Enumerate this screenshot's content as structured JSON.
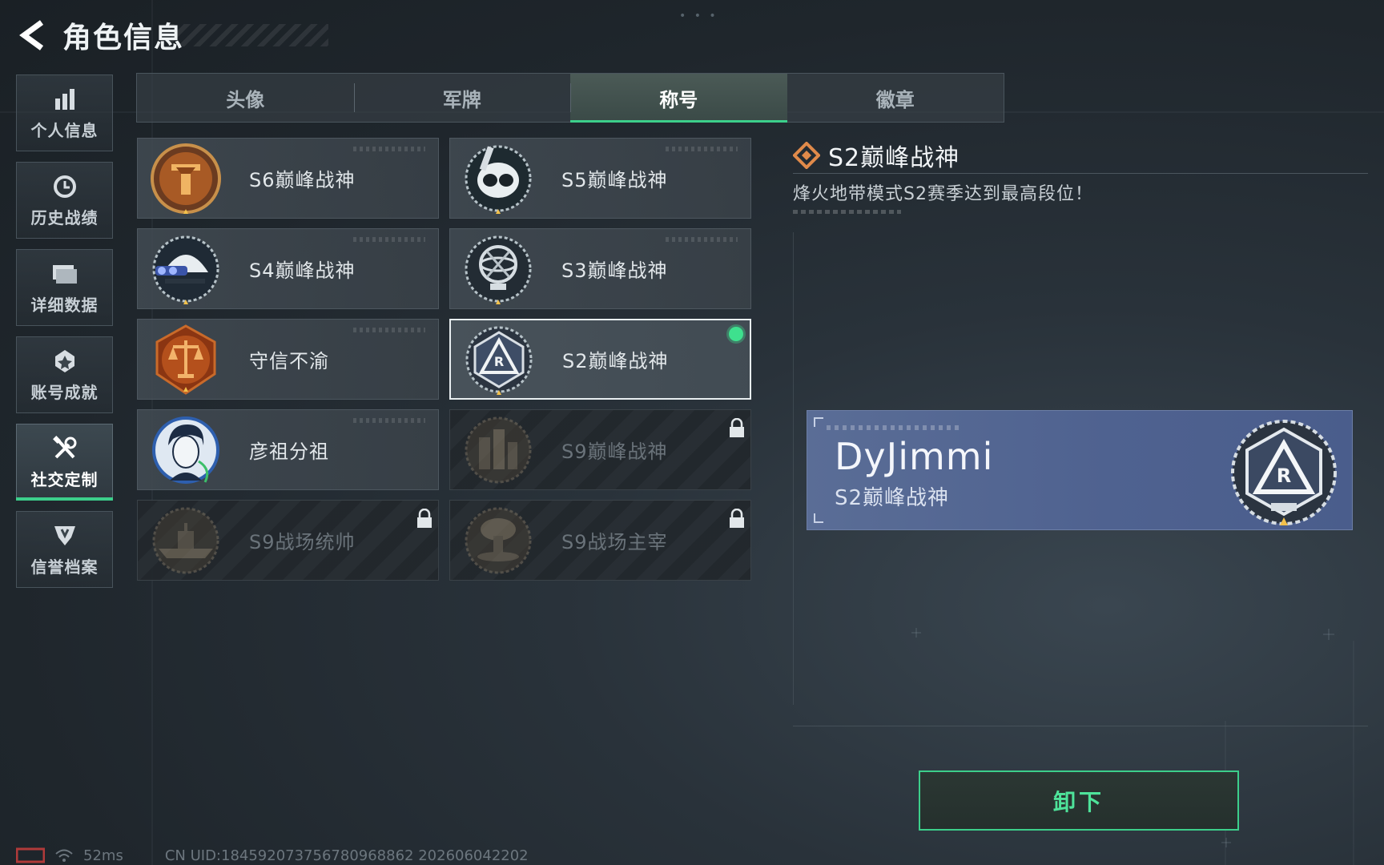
{
  "header": {
    "title": "角色信息"
  },
  "sidebar": {
    "items": [
      {
        "label": "个人信息",
        "icon": "bar-chart-icon"
      },
      {
        "label": "历史战绩",
        "icon": "history-clock-icon"
      },
      {
        "label": "详细数据",
        "icon": "folder-icon"
      },
      {
        "label": "账号成就",
        "icon": "achievement-icon"
      },
      {
        "label": "社交定制",
        "icon": "tools-icon",
        "active": true
      },
      {
        "label": "信誉档案",
        "icon": "credit-shield-icon"
      }
    ]
  },
  "tabs": [
    {
      "label": "头像"
    },
    {
      "label": "军牌"
    },
    {
      "label": "称号",
      "active": true
    },
    {
      "label": "徽章"
    }
  ],
  "titles": [
    {
      "name": "S6巅峰战神",
      "badge": "s6-badge",
      "state": "normal"
    },
    {
      "name": "S5巅峰战神",
      "badge": "s5-badge",
      "state": "normal"
    },
    {
      "name": "S4巅峰战神",
      "badge": "s4-badge",
      "state": "normal"
    },
    {
      "name": "S3巅峰战神",
      "badge": "s3-badge",
      "state": "normal"
    },
    {
      "name": "守信不渝",
      "badge": "scales-badge",
      "state": "normal"
    },
    {
      "name": "S2巅峰战神",
      "badge": "s2-badge",
      "state": "selected",
      "equipped": true
    },
    {
      "name": "彦祖分祖",
      "badge": "portrait-badge",
      "state": "normal"
    },
    {
      "name": "S9巅峰战神",
      "badge": "s9-city-badge",
      "state": "locked"
    },
    {
      "name": "S9战场统帅",
      "badge": "s9-ship-badge",
      "state": "locked"
    },
    {
      "name": "S9战场主宰",
      "badge": "s9-nuke-badge",
      "state": "locked"
    }
  ],
  "detail": {
    "title": "S2巅峰战神",
    "description": "烽火地带模式S2赛季达到最高段位！"
  },
  "nameplate": {
    "player_name": "DyJimmi",
    "title": "S2巅峰战神"
  },
  "actions": {
    "unequip_label": "卸下"
  },
  "status": {
    "ping": "52ms",
    "uid": "CN UID:18459207375678096886​2 202606042202"
  },
  "colors": {
    "accent_green": "#3ccf8b",
    "nameplate_blue": "#4f6290",
    "equipped_dot": "#3ee08e"
  }
}
